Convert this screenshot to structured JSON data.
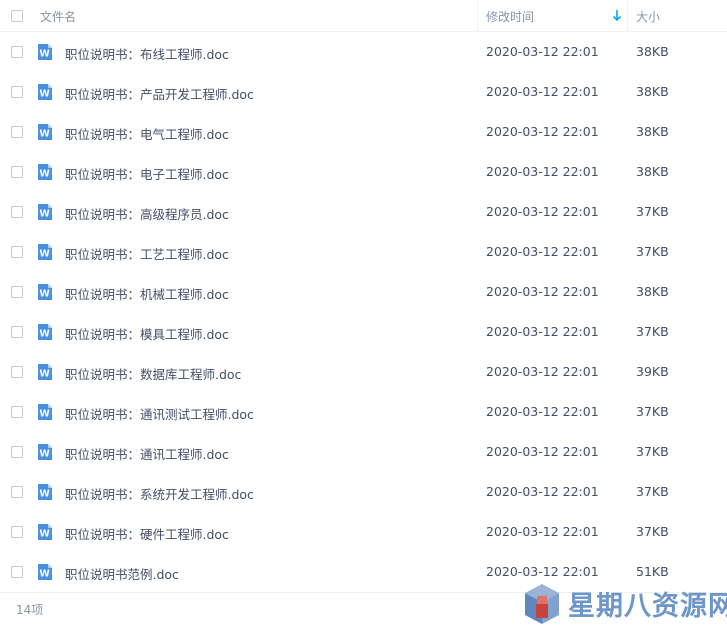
{
  "header": {
    "name_label": "文件名",
    "date_label": "修改时间",
    "size_label": "大小"
  },
  "files": [
    {
      "name": "职位说明书：布线工程师.doc",
      "date": "2020-03-12 22:01",
      "size": "38KB"
    },
    {
      "name": "职位说明书：产品开发工程师.doc",
      "date": "2020-03-12 22:01",
      "size": "38KB"
    },
    {
      "name": "职位说明书：电气工程师.doc",
      "date": "2020-03-12 22:01",
      "size": "38KB"
    },
    {
      "name": "职位说明书：电子工程师.doc",
      "date": "2020-03-12 22:01",
      "size": "38KB"
    },
    {
      "name": "职位说明书：高级程序员.doc",
      "date": "2020-03-12 22:01",
      "size": "37KB"
    },
    {
      "name": "职位说明书：工艺工程师.doc",
      "date": "2020-03-12 22:01",
      "size": "37KB"
    },
    {
      "name": "职位说明书：机械工程师.doc",
      "date": "2020-03-12 22:01",
      "size": "38KB"
    },
    {
      "name": "职位说明书：模具工程师.doc",
      "date": "2020-03-12 22:01",
      "size": "37KB"
    },
    {
      "name": "职位说明书：数据库工程师.doc",
      "date": "2020-03-12 22:01",
      "size": "39KB"
    },
    {
      "name": "职位说明书：通讯测试工程师.doc",
      "date": "2020-03-12 22:01",
      "size": "37KB"
    },
    {
      "name": "职位说明书：通讯工程师.doc",
      "date": "2020-03-12 22:01",
      "size": "37KB"
    },
    {
      "name": "职位说明书：系统开发工程师.doc",
      "date": "2020-03-12 22:01",
      "size": "37KB"
    },
    {
      "name": "职位说明书：硬件工程师.doc",
      "date": "2020-03-12 22:01",
      "size": "37KB"
    },
    {
      "name": "职位说明书范例.doc",
      "date": "2020-03-12 22:01",
      "size": "51KB"
    }
  ],
  "footer": {
    "count_text": "14项"
  },
  "watermark": {
    "text": "星期八资源网"
  },
  "icons": {
    "file": "word-doc-icon",
    "sort": "sort-down-arrow-icon",
    "logo": "cube-logo-icon"
  },
  "colors": {
    "word_blue": "#4a90e2",
    "accent": "#06a7ff",
    "watermark": "#6e96c8"
  }
}
